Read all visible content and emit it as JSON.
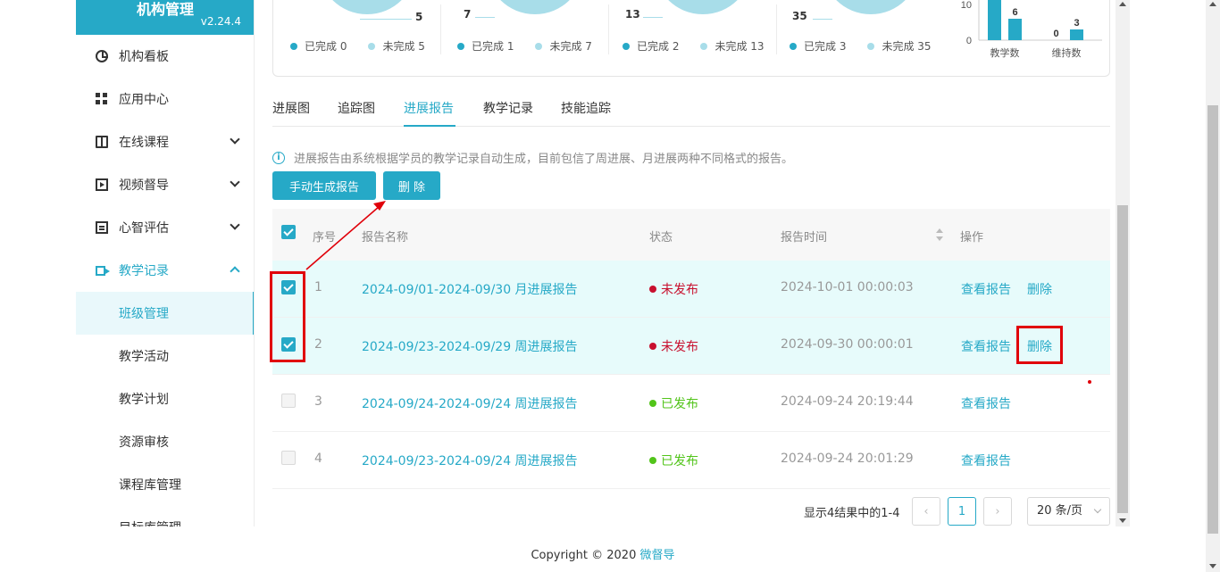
{
  "sidebar": {
    "brand_title": "机构管理",
    "version": "v2.24.4",
    "items": [
      {
        "label": "机构看板",
        "icon": "dashboard-icon"
      },
      {
        "label": "应用中心",
        "icon": "grid-icon"
      },
      {
        "label": "在线课程",
        "icon": "book-icon"
      },
      {
        "label": "视频督导",
        "icon": "video-play-icon"
      },
      {
        "label": "心智评估",
        "icon": "document-icon"
      },
      {
        "label": "教学记录",
        "icon": "camera-icon"
      }
    ],
    "sub_items": [
      {
        "label": "班级管理"
      },
      {
        "label": "教学活动"
      },
      {
        "label": "教学计划"
      },
      {
        "label": "资源审核"
      },
      {
        "label": "课程库管理"
      },
      {
        "label": "目标库管理"
      }
    ]
  },
  "summary": {
    "blocks": [
      {
        "value": "5",
        "done_label": "已完成 0",
        "undone_label": "未完成 5"
      },
      {
        "value": "7",
        "done_label": "已完成 1",
        "undone_label": "未完成 7"
      },
      {
        "value": "13",
        "done_label": "已完成 2",
        "undone_label": "未完成 13"
      },
      {
        "value": "35",
        "done_label": "已完成 3",
        "undone_label": "未完成 35"
      }
    ],
    "colors": {
      "done": "#26a9c7",
      "undone": "#a8dde9"
    }
  },
  "chart_data": {
    "type": "bar",
    "categories": [
      "教学数",
      "维持数"
    ],
    "series": [
      {
        "values": [
          13,
          0
        ]
      },
      {
        "values": [
          6,
          3
        ]
      }
    ],
    "ytick_labels": [
      "10",
      "0"
    ],
    "ylim": [
      0,
      10
    ],
    "data_labels": [
      "6",
      "0",
      "3"
    ]
  },
  "tabs": [
    {
      "label": "进展图"
    },
    {
      "label": "追踪图"
    },
    {
      "label": "进展报告"
    },
    {
      "label": "教学记录"
    },
    {
      "label": "技能追踪"
    }
  ],
  "info_text": "进展报告由系统根据学员的教学记录自动生成，目前包信了周进展、月进展两种不同格式的报告。",
  "buttons": {
    "generate": "手动生成报告",
    "delete": "删 除"
  },
  "table": {
    "headers": {
      "index": "序号",
      "name": "报告名称",
      "status": "状态",
      "time": "报告时间",
      "action": "操作"
    },
    "rows": [
      {
        "index": "1",
        "name": "2024-09/01-2024-09/30 月进展报告",
        "status": "未发布",
        "status_color": "#c8102e",
        "time": "2024-10-01 00:00:03",
        "view": "查看报告",
        "delete": "删除",
        "selected": true
      },
      {
        "index": "2",
        "name": "2024-09/23-2024-09/29 周进展报告",
        "status": "未发布",
        "status_color": "#c8102e",
        "time": "2024-09-30 00:00:01",
        "view": "查看报告",
        "delete": "删除",
        "selected": true
      },
      {
        "index": "3",
        "name": "2024-09/24-2024-09/24 周进展报告",
        "status": "已发布",
        "status_color": "#52c41a",
        "time": "2024-09-24 20:19:44",
        "view": "查看报告",
        "delete": "",
        "selected": false
      },
      {
        "index": "4",
        "name": "2024-09/23-2024-09/24 周进展报告",
        "status": "已发布",
        "status_color": "#52c41a",
        "time": "2024-09-24 20:01:29",
        "view": "查看报告",
        "delete": "",
        "selected": false
      }
    ]
  },
  "pagination": {
    "summary": "显示4结果中的1-4",
    "current_page": "1",
    "page_size": "20 条/页"
  },
  "footer": {
    "copyright": "Copyright © 2020 ",
    "brand": "微督导"
  },
  "colors": {
    "accent": "#26a9c7",
    "annotation": "#e0000a"
  }
}
